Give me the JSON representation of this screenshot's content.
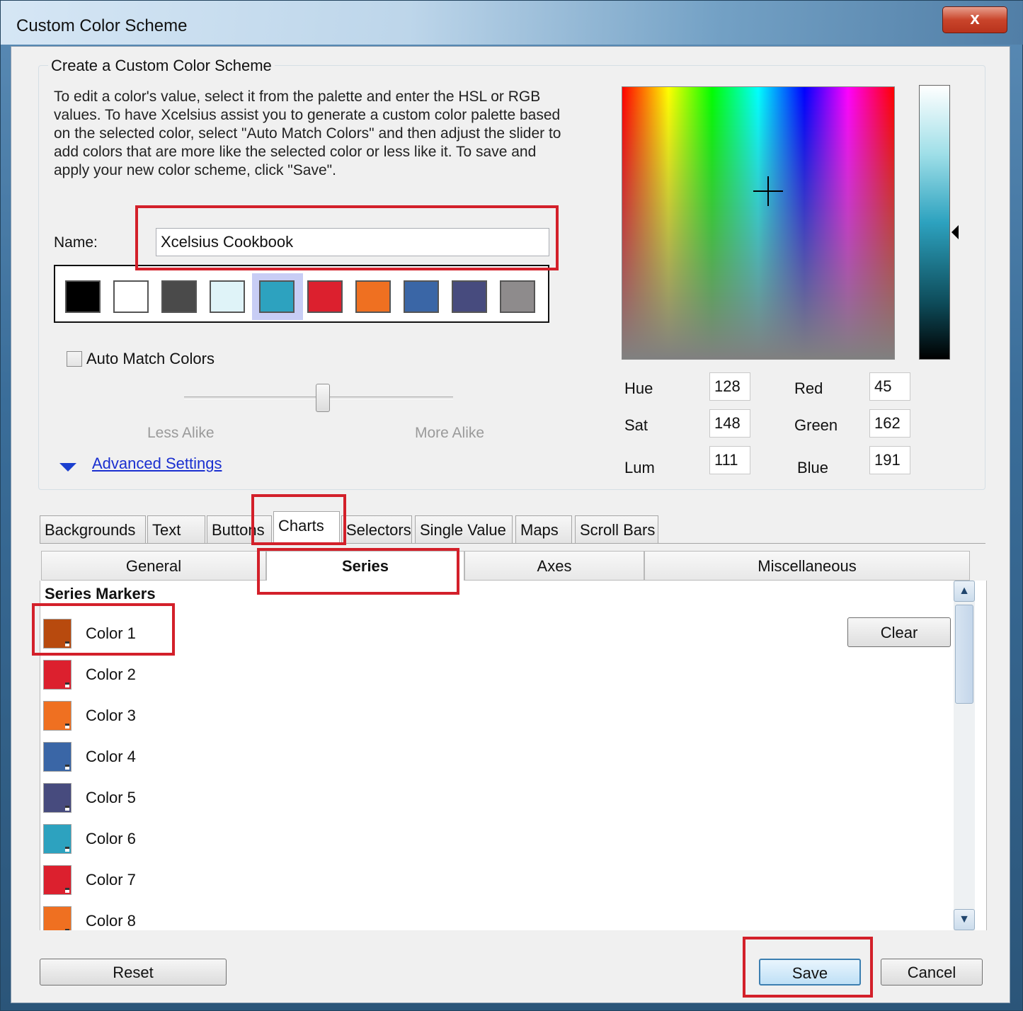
{
  "window": {
    "title": "Custom Color Scheme",
    "close_label": "x"
  },
  "group": {
    "title": "Create a Custom Color Scheme",
    "description": "To edit a color's value, select it from the palette and enter the HSL or RGB values. To have Xcelsius  assist you to generate a custom color palette based on the selected color, select \"Auto Match Colors\" and then adjust the slider to add colors that are more like the selected color or less like it. To save and apply your new color scheme, click \"Save\".",
    "name_label": "Name:",
    "name_value": "Xcelsius Cookbook",
    "palette": [
      "#000000",
      "#ffffff",
      "#4a4a4a",
      "#dff3f8",
      "#2da2bf",
      "#dc202e",
      "#ef7021",
      "#3a66a6",
      "#474b7e",
      "#8e8b8c"
    ],
    "selected_swatch_index": 4,
    "auto_match_label": "Auto Match Colors",
    "auto_match_checked": false,
    "less_alike_label": "Less Alike",
    "more_alike_label": "More Alike",
    "advanced_settings_label": "Advanced Settings"
  },
  "picker": {
    "hue_label": "Hue",
    "hue": "128",
    "sat_label": "Sat",
    "sat": "148",
    "lum_label": "Lum",
    "lum": "111",
    "red_label": "Red",
    "red": "45",
    "green_label": "Green",
    "green": "162",
    "blue_label": "Blue",
    "blue": "191"
  },
  "tabs": [
    "Backgrounds",
    "Text",
    "Buttons",
    "Charts",
    "Selectors",
    "Single Value",
    "Maps",
    "Scroll Bars"
  ],
  "active_tab": "Charts",
  "subtabs": [
    "General",
    "Series",
    "Axes",
    "Miscellaneous"
  ],
  "active_subtab": "Series",
  "series_markers": {
    "title": "Series Markers",
    "clear_label": "Clear",
    "items": [
      {
        "label": "Color 1",
        "color": "#b84a0e"
      },
      {
        "label": "Color 2",
        "color": "#dc202e"
      },
      {
        "label": "Color 3",
        "color": "#ef7021"
      },
      {
        "label": "Color 4",
        "color": "#3a66a6"
      },
      {
        "label": "Color 5",
        "color": "#474b7e"
      },
      {
        "label": "Color 6",
        "color": "#2da2bf"
      },
      {
        "label": "Color 7",
        "color": "#dc202e"
      },
      {
        "label": "Color 8",
        "color": "#ef7021"
      }
    ]
  },
  "footer": {
    "reset_label": "Reset",
    "save_label": "Save",
    "cancel_label": "Cancel"
  },
  "highlight_color": "#d3202a"
}
